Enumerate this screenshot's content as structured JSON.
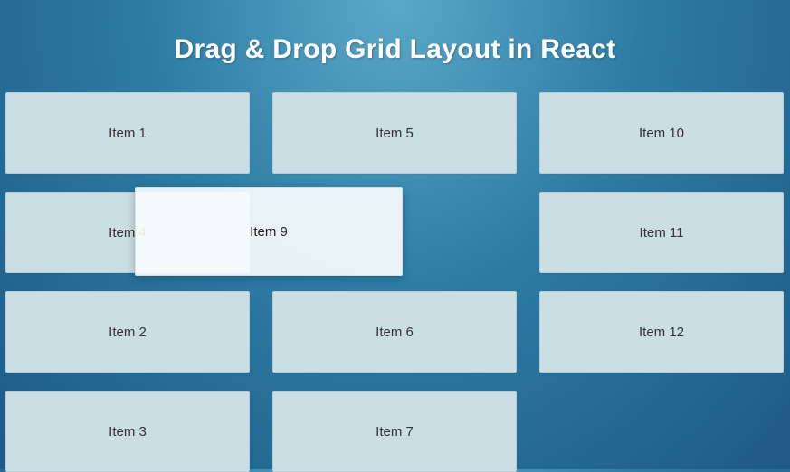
{
  "header": {
    "title": "Drag & Drop Grid Layout in React"
  },
  "grid": {
    "cells": [
      {
        "label": "Item 1"
      },
      {
        "label": "Item 5"
      },
      {
        "label": "Item 10"
      },
      {
        "label": "Item 4"
      },
      null,
      {
        "label": "Item 11"
      },
      {
        "label": "Item 2"
      },
      {
        "label": "Item 6"
      },
      {
        "label": "Item 12"
      },
      {
        "label": "Item 3"
      },
      {
        "label": "Item 7"
      },
      null
    ]
  },
  "dragging": {
    "label": "Item 9"
  }
}
